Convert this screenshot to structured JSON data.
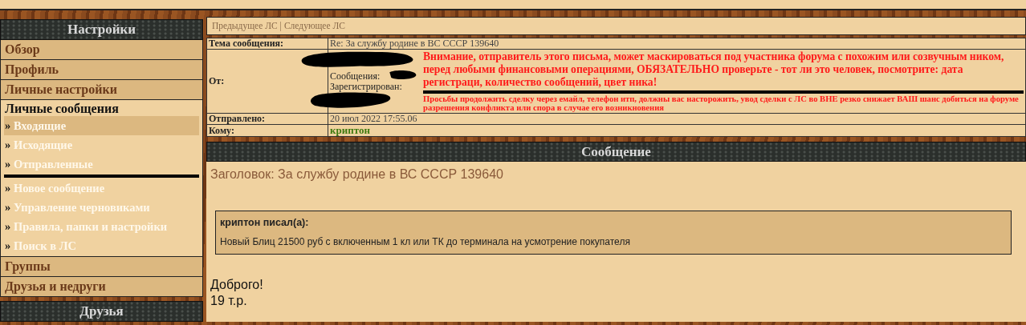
{
  "sidebar": {
    "title": "Настройки",
    "items": [
      {
        "kind": "link",
        "label": "Обзор"
      },
      {
        "kind": "link",
        "label": "Профиль"
      },
      {
        "kind": "link",
        "label": "Личные настройки"
      },
      {
        "kind": "group",
        "label": "Личные сообщения",
        "folders": [
          {
            "label": "Входящие",
            "selected": true
          },
          {
            "label": "Исходящие",
            "selected": false
          },
          {
            "label": "Отправленные",
            "selected": false
          }
        ],
        "actions": [
          {
            "label": "Новое сообщение",
            "selected": false
          },
          {
            "label": "Управление черновиками",
            "selected": false
          },
          {
            "label": "Правила, папки и настройки",
            "selected": false
          },
          {
            "label": "Поиск в ЛС",
            "selected": false
          }
        ],
        "bullet": "»"
      },
      {
        "kind": "link",
        "label": "Группы"
      },
      {
        "kind": "link",
        "label": "Друзья и недруги"
      }
    ]
  },
  "friends_panel": {
    "title": "Друзья"
  },
  "message_nav": {
    "links": [
      "Предыдущее ЛС",
      "Следующее ЛС"
    ],
    "separator": "|"
  },
  "header_table": [
    {
      "kind": "text",
      "label": "Тема сообщения:",
      "value": "Re: За службу родине в ВС СССР 139640"
    },
    {
      "kind": "sender",
      "label": "От:",
      "fields": [
        "Сообщения:",
        "Зарегистрирован:"
      ],
      "warning": "Внимание, отправитель этого письма, может маскироваться под участника форума с похожим или созвучным ником, перед любыми финансовыми операциями, ОБЯЗАТЕЛЬНО проверьте - тот ли это человек, посмотрите: дата регистраци, количество сообщений, цвет ника!",
      "notice": "Просьбы продолжить сделку через емайл, телефон итп, должны вас насторожить, увод сделки с ЛС во ВНЕ резко снижает ВАШ шанс добиться на форуме разрешения конфликта или спора в случае его возникновения"
    },
    {
      "kind": "text",
      "label": "Отправлено:",
      "value": "20 июл 2022 17:55.06"
    },
    {
      "kind": "user",
      "label": "Кому:",
      "value": "криптон"
    }
  ],
  "message": {
    "title": "Сообщение",
    "subject": "Заголовок: За службу родине в ВС СССР 139640",
    "quote": {
      "author": "криптон писал(а):",
      "text": "Новый Блиц 21500 руб с включенным 1 кл или ТК до терминала на усмотрение покупателя"
    },
    "body": [
      "Доброго!",
      "19 т.р."
    ]
  }
}
